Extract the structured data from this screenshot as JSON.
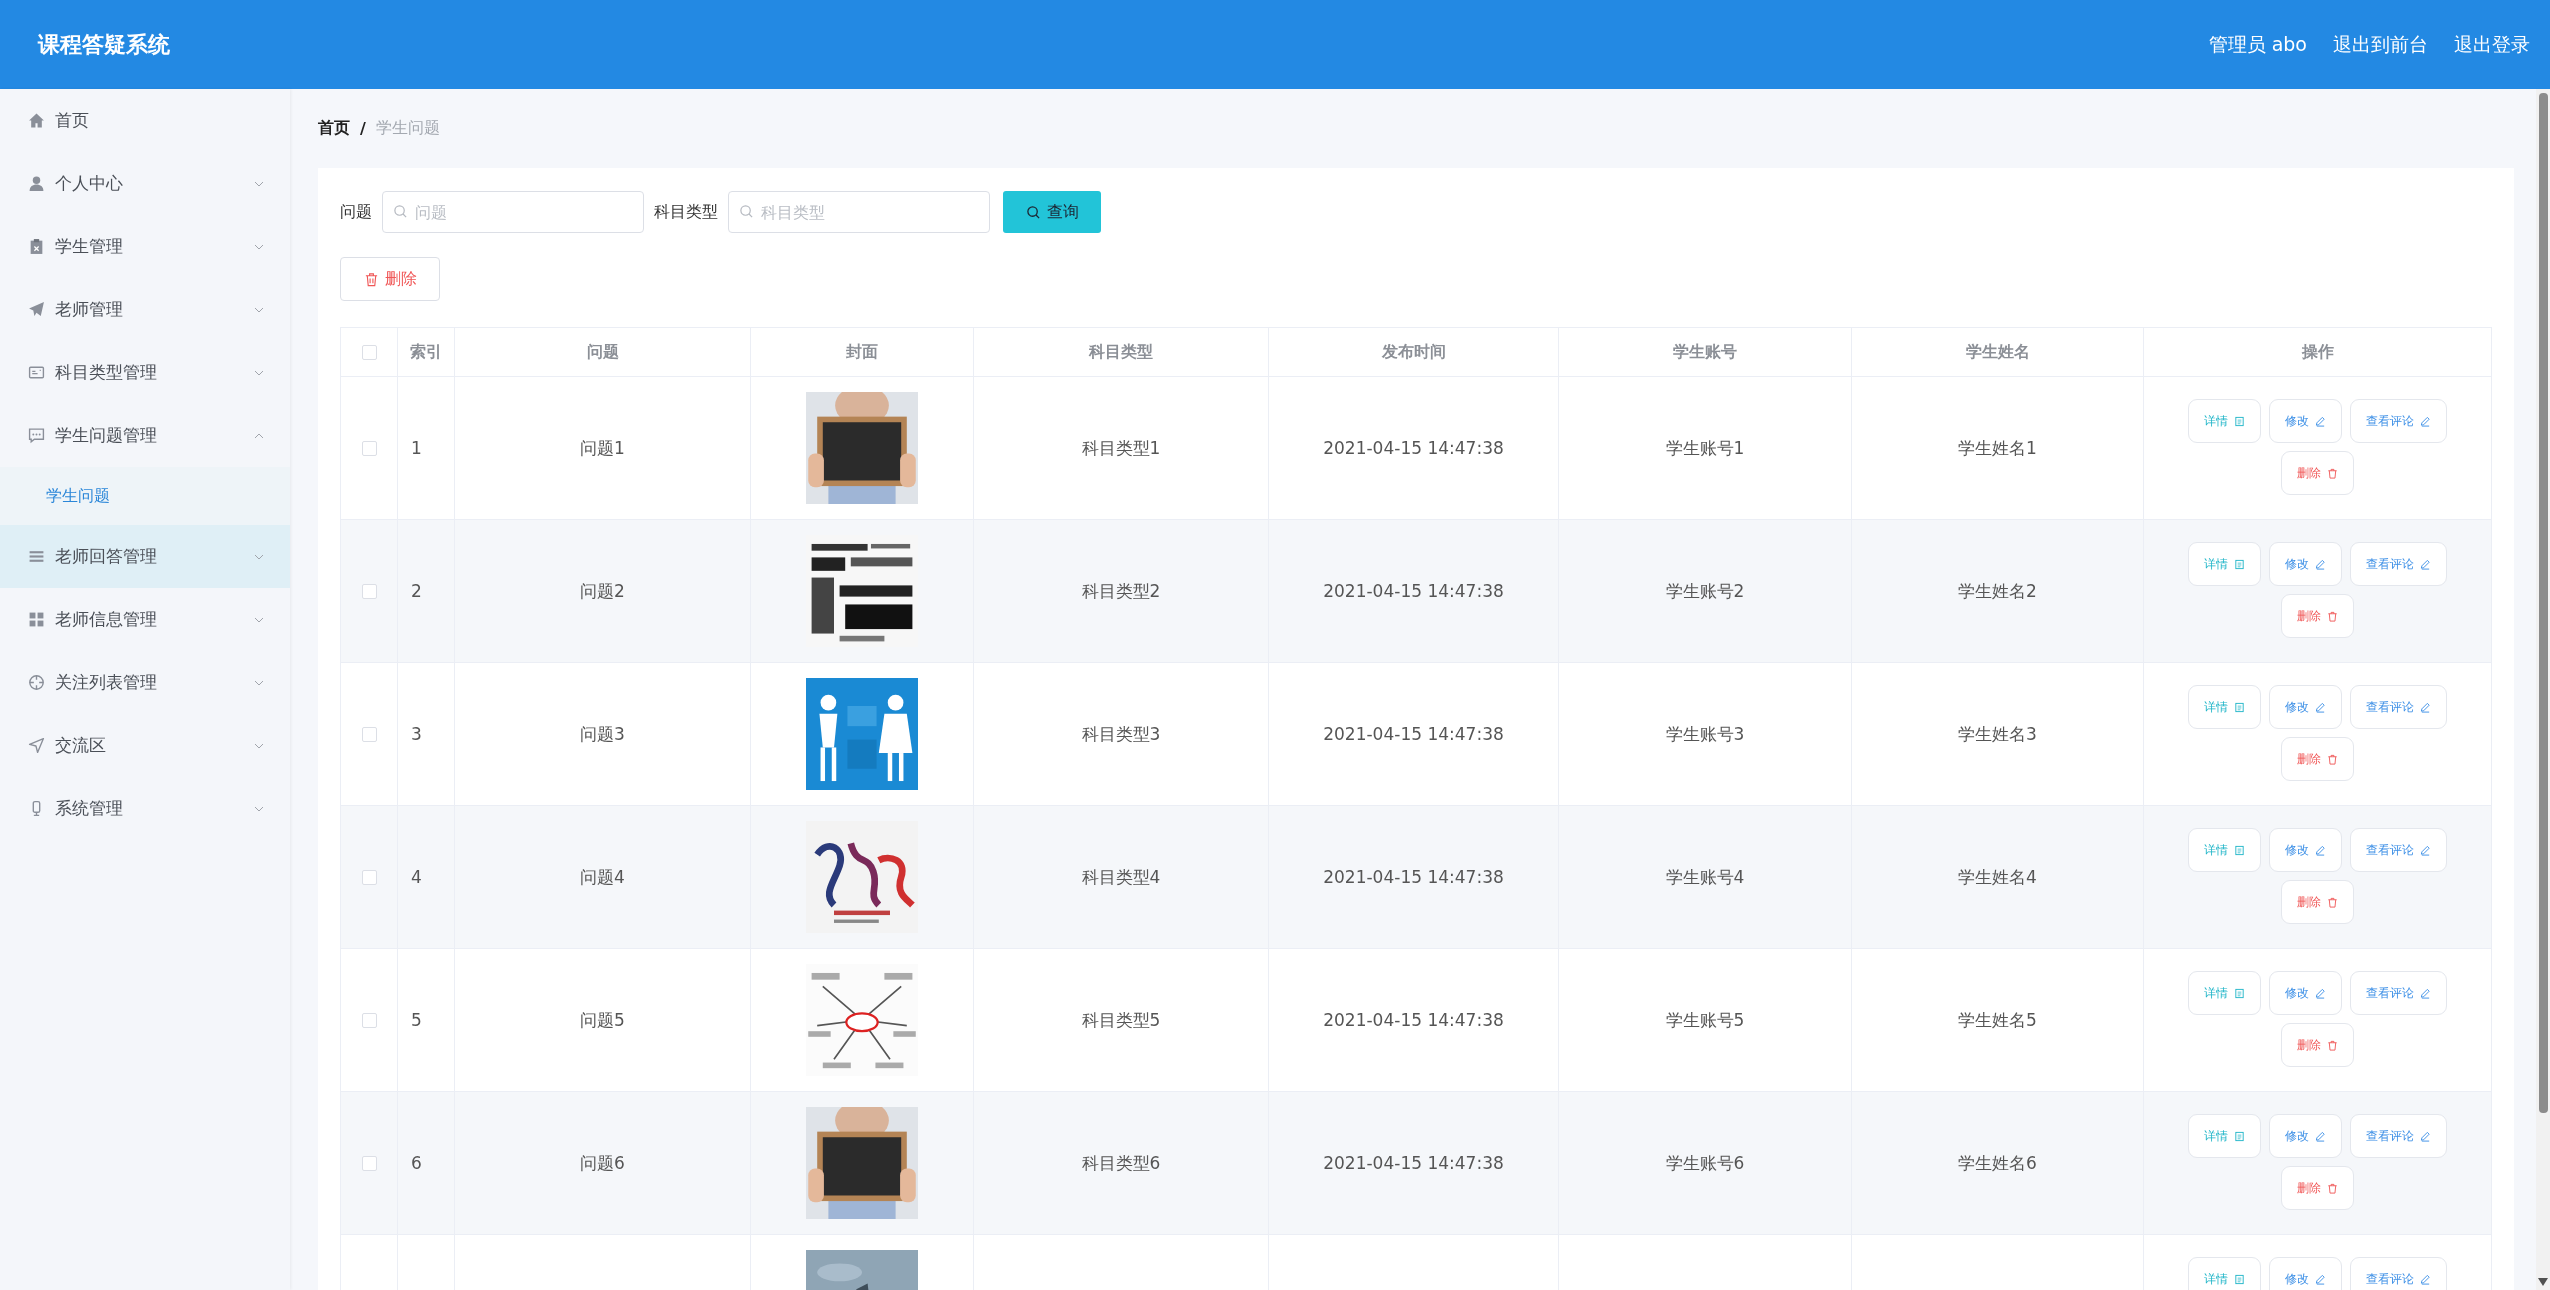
{
  "header": {
    "title": "课程答疑系统",
    "links": [
      "管理员 abo",
      "退出到前台",
      "退出登录"
    ]
  },
  "sidebar": {
    "items": [
      {
        "label": "首页",
        "kind": "link",
        "hovered": false
      },
      {
        "label": "个人中心",
        "kind": "menu",
        "expanded": false,
        "hovered": false
      },
      {
        "label": "学生管理",
        "kind": "menu",
        "expanded": false,
        "hovered": false
      },
      {
        "label": "老师管理",
        "kind": "menu",
        "expanded": false,
        "hovered": false
      },
      {
        "label": "科目类型管理",
        "kind": "menu",
        "expanded": false,
        "hovered": false
      },
      {
        "label": "学生问题管理",
        "kind": "menu",
        "expanded": true,
        "hovered": false,
        "children": [
          {
            "label": "学生问题",
            "selected": true
          }
        ]
      },
      {
        "label": "老师回答管理",
        "kind": "menu",
        "expanded": false,
        "hovered": true
      },
      {
        "label": "老师信息管理",
        "kind": "menu",
        "expanded": false,
        "hovered": false
      },
      {
        "label": "关注列表管理",
        "kind": "menu",
        "expanded": false,
        "hovered": false
      },
      {
        "label": "交流区",
        "kind": "menu",
        "expanded": false,
        "hovered": false
      },
      {
        "label": "系统管理",
        "kind": "menu",
        "expanded": false,
        "hovered": false
      }
    ]
  },
  "breadcrumb": {
    "items": [
      "首页",
      "学生问题"
    ],
    "separator": "/"
  },
  "search": {
    "fields": [
      {
        "label": "问题",
        "placeholder": "问题"
      },
      {
        "label": "科目类型",
        "placeholder": "科目类型"
      }
    ],
    "button": "查询"
  },
  "delete_button": "删除",
  "table": {
    "select_all_checked": false,
    "columns": [
      "索引",
      "问题",
      "封面",
      "科目类型",
      "发布时间",
      "学生账号",
      "学生姓名",
      "操作"
    ],
    "rows": [
      {
        "checked": false,
        "index": "1",
        "question": "问题1",
        "cover": {
          "kind": "picture"
        },
        "subject": "科目类型1",
        "time": "2021-04-15 14:47:38",
        "account": "学生账号1",
        "name": "学生姓名1",
        "actions": [
          {
            "label": "详情",
            "kind": "detail"
          },
          {
            "label": "修改",
            "kind": "edit"
          },
          {
            "label": "查看评论",
            "kind": "comment"
          },
          {
            "label": "删除",
            "kind": "delete"
          }
        ]
      },
      {
        "checked": false,
        "index": "2",
        "question": "问题2",
        "cover": {
          "kind": "picture"
        },
        "subject": "科目类型2",
        "time": "2021-04-15 14:47:38",
        "account": "学生账号2",
        "name": "学生姓名2",
        "actions": [
          {
            "label": "详情",
            "kind": "detail"
          },
          {
            "label": "修改",
            "kind": "edit"
          },
          {
            "label": "查看评论",
            "kind": "comment"
          },
          {
            "label": "删除",
            "kind": "delete"
          }
        ]
      },
      {
        "checked": false,
        "index": "3",
        "question": "问题3",
        "cover": {
          "kind": "picture"
        },
        "subject": "科目类型3",
        "time": "2021-04-15 14:47:38",
        "account": "学生账号3",
        "name": "学生姓名3",
        "actions": [
          {
            "label": "详情",
            "kind": "detail"
          },
          {
            "label": "修改",
            "kind": "edit"
          },
          {
            "label": "查看评论",
            "kind": "comment"
          },
          {
            "label": "删除",
            "kind": "delete"
          }
        ]
      },
      {
        "checked": false,
        "index": "4",
        "question": "问题4",
        "cover": {
          "kind": "picture"
        },
        "subject": "科目类型4",
        "time": "2021-04-15 14:47:38",
        "account": "学生账号4",
        "name": "学生姓名4",
        "actions": [
          {
            "label": "详情",
            "kind": "detail"
          },
          {
            "label": "修改",
            "kind": "edit"
          },
          {
            "label": "查看评论",
            "kind": "comment"
          },
          {
            "label": "删除",
            "kind": "delete"
          }
        ]
      },
      {
        "checked": false,
        "index": "5",
        "question": "问题5",
        "cover": {
          "kind": "picture"
        },
        "subject": "科目类型5",
        "time": "2021-04-15 14:47:38",
        "account": "学生账号5",
        "name": "学生姓名5",
        "actions": [
          {
            "label": "详情",
            "kind": "detail"
          },
          {
            "label": "修改",
            "kind": "edit"
          },
          {
            "label": "查看评论",
            "kind": "comment"
          },
          {
            "label": "删除",
            "kind": "delete"
          }
        ]
      },
      {
        "checked": false,
        "index": "6",
        "question": "问题6",
        "cover": {
          "kind": "picture"
        },
        "subject": "科目类型6",
        "time": "2021-04-15 14:47:38",
        "account": "学生账号6",
        "name": "学生姓名6",
        "actions": [
          {
            "label": "详情",
            "kind": "detail"
          },
          {
            "label": "修改",
            "kind": "edit"
          },
          {
            "label": "查看评论",
            "kind": "comment"
          },
          {
            "label": "删除",
            "kind": "delete"
          }
        ]
      },
      {
        "cover": {
          "kind": "picture"
        },
        "actions": [
          {
            "label": "详情",
            "kind": "detail"
          },
          {
            "label": "修改",
            "kind": "edit"
          },
          {
            "label": "查看评论",
            "kind": "comment"
          }
        ]
      }
    ]
  }
}
